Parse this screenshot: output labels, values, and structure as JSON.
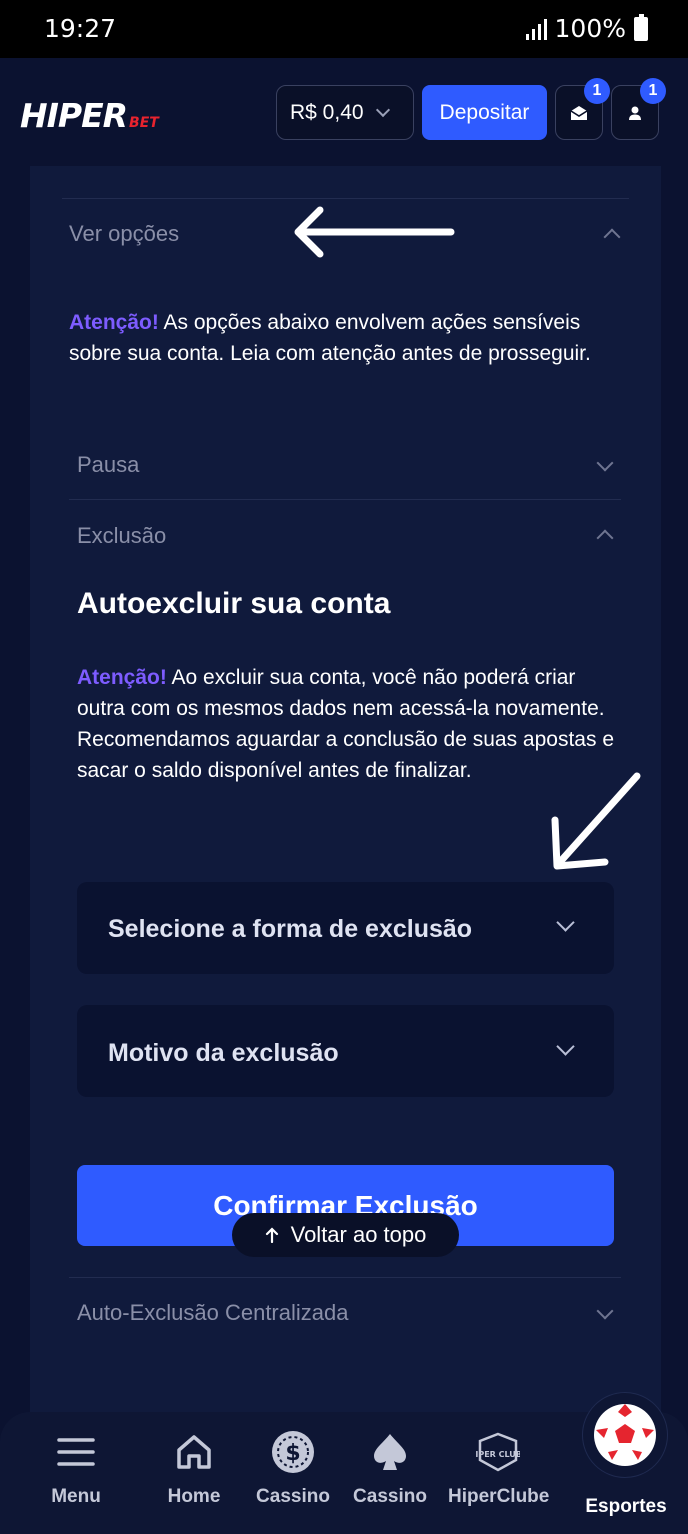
{
  "status_bar": {
    "time": "19:27",
    "battery": "100%"
  },
  "header": {
    "logo_main": "HIPER",
    "logo_sub": "BET",
    "balance": "R$ 0,40",
    "deposit_label": "Depositar",
    "mail_badge": "1",
    "profile_badge": "1"
  },
  "panel": {
    "options_label": "Ver opções",
    "warning_prefix": "Atenção!",
    "warning_text": " As opções abaixo envolvem ações sensíveis sobre sua conta. Leia com atenção antes de prosseguir.",
    "pause_label": "Pausa",
    "exclusion_label": "Exclusão",
    "exclusion_title": "Autoexcluir sua conta",
    "exclusion_warning_prefix": "Atenção!",
    "exclusion_warning_text": " Ao excluir sua conta, você não poderá criar outra com os mesmos dados nem acessá-la novamente. Recomendamos aguardar a conclusão de suas apostas e sacar o saldo disponível antes de finalizar.",
    "select_type_label": "Selecione a forma de exclusão",
    "select_reason_label": "Motivo da exclusão",
    "confirm_label": "Confirmar Exclusão",
    "back_to_top_label": "Voltar ao topo",
    "central_exclusion_label": "Auto-Exclusão Centralizada"
  },
  "bottom_nav": {
    "items": [
      {
        "label": "Menu",
        "icon": "hamburger-icon"
      },
      {
        "label": "Home",
        "icon": "home-icon"
      },
      {
        "label": "Cassino",
        "icon": "coin-icon"
      },
      {
        "label": "Cassino",
        "icon": "spade-icon"
      },
      {
        "label": "HiperClube",
        "icon": "hiperclube-icon"
      },
      {
        "label": "Esportes",
        "icon": "soccer-ball-icon"
      }
    ],
    "club_icon_text": "HIPER CLUBE"
  },
  "colors": {
    "background": "#0b1230",
    "panel": "#101a3c",
    "primary": "#2f5bff",
    "accent": "#7d5cff"
  }
}
